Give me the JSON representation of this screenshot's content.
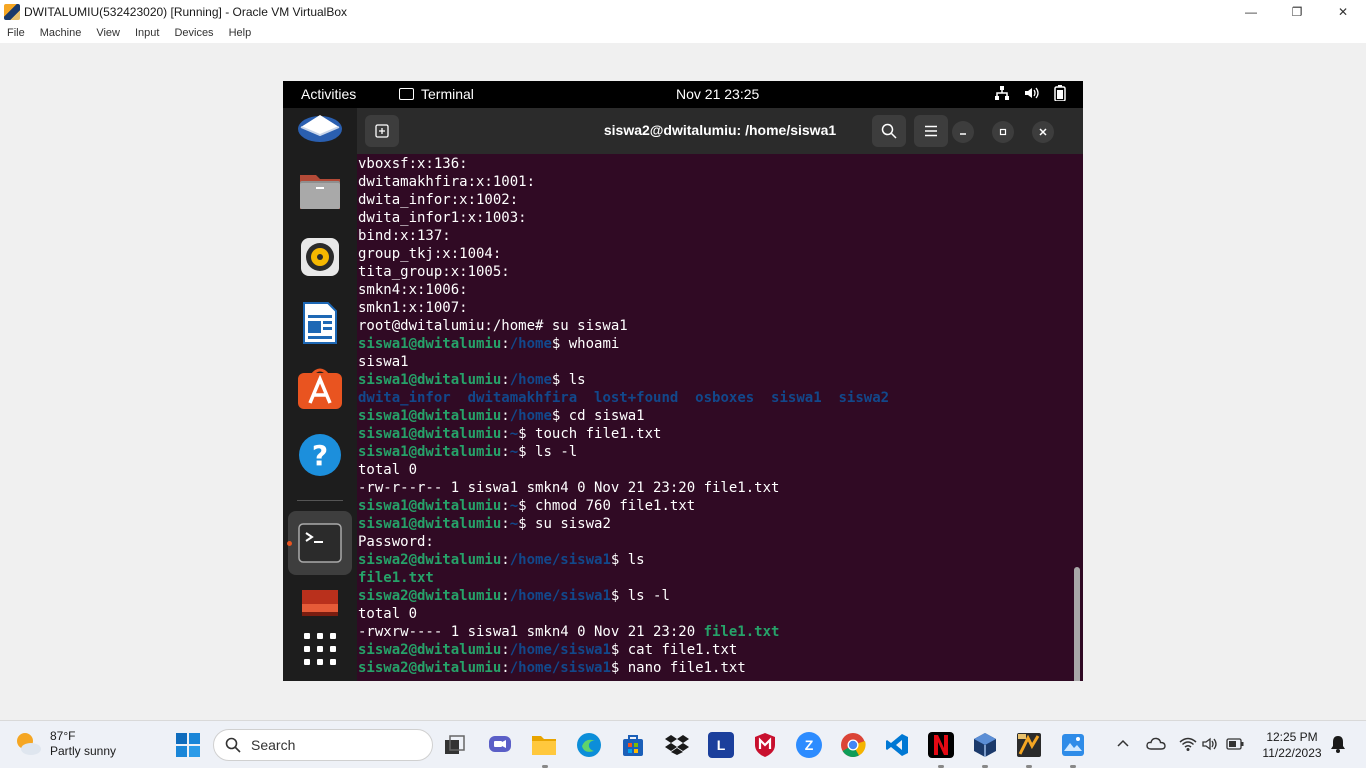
{
  "host": {
    "window_title": "DWITALUMIU(532423020) [Running] - Oracle VM VirtualBox",
    "controls": {
      "minimize": "—",
      "maximize": "❐",
      "close": "✕"
    },
    "menu": [
      "File",
      "Machine",
      "View",
      "Input",
      "Devices",
      "Help"
    ]
  },
  "ubuntu": {
    "activities": "Activities",
    "app_name": "Terminal",
    "clock": "Nov 21  23:25"
  },
  "terminal": {
    "title": "siswa2@dwitalumiu: /home/siswa1",
    "lines": [
      [
        {
          "t": "vboxsf:x:136:",
          "c": ""
        }
      ],
      [
        {
          "t": "dwitamakhfira:x:1001:",
          "c": ""
        }
      ],
      [
        {
          "t": "dwita_infor:x:1002:",
          "c": ""
        }
      ],
      [
        {
          "t": "dwita_infor1:x:1003:",
          "c": ""
        }
      ],
      [
        {
          "t": "bind:x:137:",
          "c": ""
        }
      ],
      [
        {
          "t": "group_tkj:x:1004:",
          "c": ""
        }
      ],
      [
        {
          "t": "tita_group:x:1005:",
          "c": ""
        }
      ],
      [
        {
          "t": "smkn4:x:1006:",
          "c": ""
        }
      ],
      [
        {
          "t": "smkn1:x:1007:",
          "c": ""
        }
      ],
      [
        {
          "t": "root@dwitalumiu:/home# su siswa1",
          "c": ""
        }
      ],
      [
        {
          "t": "siswa1@dwitalumiu",
          "c": "prompt-user"
        },
        {
          "t": ":",
          "c": ""
        },
        {
          "t": "/home",
          "c": "prompt-path"
        },
        {
          "t": "$ whoami",
          "c": ""
        }
      ],
      [
        {
          "t": "siswa1",
          "c": ""
        }
      ],
      [
        {
          "t": "siswa1@dwitalumiu",
          "c": "prompt-user"
        },
        {
          "t": ":",
          "c": ""
        },
        {
          "t": "/home",
          "c": "prompt-path"
        },
        {
          "t": "$ ls",
          "c": ""
        }
      ],
      [
        {
          "t": "dwita_infor",
          "c": "dir"
        },
        {
          "t": "  ",
          "c": ""
        },
        {
          "t": "dwitamakhfira",
          "c": "dir"
        },
        {
          "t": "  ",
          "c": ""
        },
        {
          "t": "lost+found",
          "c": "dir"
        },
        {
          "t": "  ",
          "c": ""
        },
        {
          "t": "osboxes",
          "c": "dir"
        },
        {
          "t": "  ",
          "c": ""
        },
        {
          "t": "siswa1",
          "c": "dir"
        },
        {
          "t": "  ",
          "c": ""
        },
        {
          "t": "siswa2",
          "c": "dir"
        }
      ],
      [
        {
          "t": "siswa1@dwitalumiu",
          "c": "prompt-user"
        },
        {
          "t": ":",
          "c": ""
        },
        {
          "t": "/home",
          "c": "prompt-path"
        },
        {
          "t": "$ cd siswa1",
          "c": ""
        }
      ],
      [
        {
          "t": "siswa1@dwitalumiu",
          "c": "prompt-user"
        },
        {
          "t": ":",
          "c": ""
        },
        {
          "t": "~",
          "c": "prompt-path"
        },
        {
          "t": "$ touch file1.txt",
          "c": ""
        }
      ],
      [
        {
          "t": "siswa1@dwitalumiu",
          "c": "prompt-user"
        },
        {
          "t": ":",
          "c": ""
        },
        {
          "t": "~",
          "c": "prompt-path"
        },
        {
          "t": "$ ls -l",
          "c": ""
        }
      ],
      [
        {
          "t": "total 0",
          "c": ""
        }
      ],
      [
        {
          "t": "-rw-r--r-- 1 siswa1 smkn4 0 Nov 21 23:20 file1.txt",
          "c": ""
        }
      ],
      [
        {
          "t": "siswa1@dwitalumiu",
          "c": "prompt-user"
        },
        {
          "t": ":",
          "c": ""
        },
        {
          "t": "~",
          "c": "prompt-path"
        },
        {
          "t": "$ chmod 760 file1.txt",
          "c": ""
        }
      ],
      [
        {
          "t": "siswa1@dwitalumiu",
          "c": "prompt-user"
        },
        {
          "t": ":",
          "c": ""
        },
        {
          "t": "~",
          "c": "prompt-path"
        },
        {
          "t": "$ su siswa2",
          "c": ""
        }
      ],
      [
        {
          "t": "Password:",
          "c": ""
        }
      ],
      [
        {
          "t": "siswa2@dwitalumiu",
          "c": "prompt-user"
        },
        {
          "t": ":",
          "c": ""
        },
        {
          "t": "/home/siswa1",
          "c": "prompt-path"
        },
        {
          "t": "$ ls",
          "c": ""
        }
      ],
      [
        {
          "t": "file1.txt",
          "c": "exec"
        }
      ],
      [
        {
          "t": "siswa2@dwitalumiu",
          "c": "prompt-user"
        },
        {
          "t": ":",
          "c": ""
        },
        {
          "t": "/home/siswa1",
          "c": "prompt-path"
        },
        {
          "t": "$ ls -l",
          "c": ""
        }
      ],
      [
        {
          "t": "total 0",
          "c": ""
        }
      ],
      [
        {
          "t": "-rwxrw---- 1 siswa1 smkn4 0 Nov 21 23:20 ",
          "c": ""
        },
        {
          "t": "file1.txt",
          "c": "exec"
        }
      ],
      [
        {
          "t": "siswa2@dwitalumiu",
          "c": "prompt-user"
        },
        {
          "t": ":",
          "c": ""
        },
        {
          "t": "/home/siswa1",
          "c": "prompt-path"
        },
        {
          "t": "$ cat file1.txt",
          "c": ""
        }
      ],
      [
        {
          "t": "siswa2@dwitalumiu",
          "c": "prompt-user"
        },
        {
          "t": ":",
          "c": ""
        },
        {
          "t": "/home/siswa1",
          "c": "prompt-path"
        },
        {
          "t": "$ nano file1.txt",
          "c": ""
        }
      ]
    ]
  },
  "taskbar": {
    "weather_temp": "87°F",
    "weather_desc": "Partly sunny",
    "search_placeholder": "Search",
    "time": "12:25 PM",
    "date": "11/22/2023",
    "icons": {
      "launcher_letter": "L",
      "zoom_letter": "Z"
    }
  },
  "colors": {
    "terminal_bg": "#300a24",
    "prompt_user": "#26a269",
    "prompt_path": "#12488b",
    "topbar": "#000000",
    "dock": "#1d1d1d"
  }
}
